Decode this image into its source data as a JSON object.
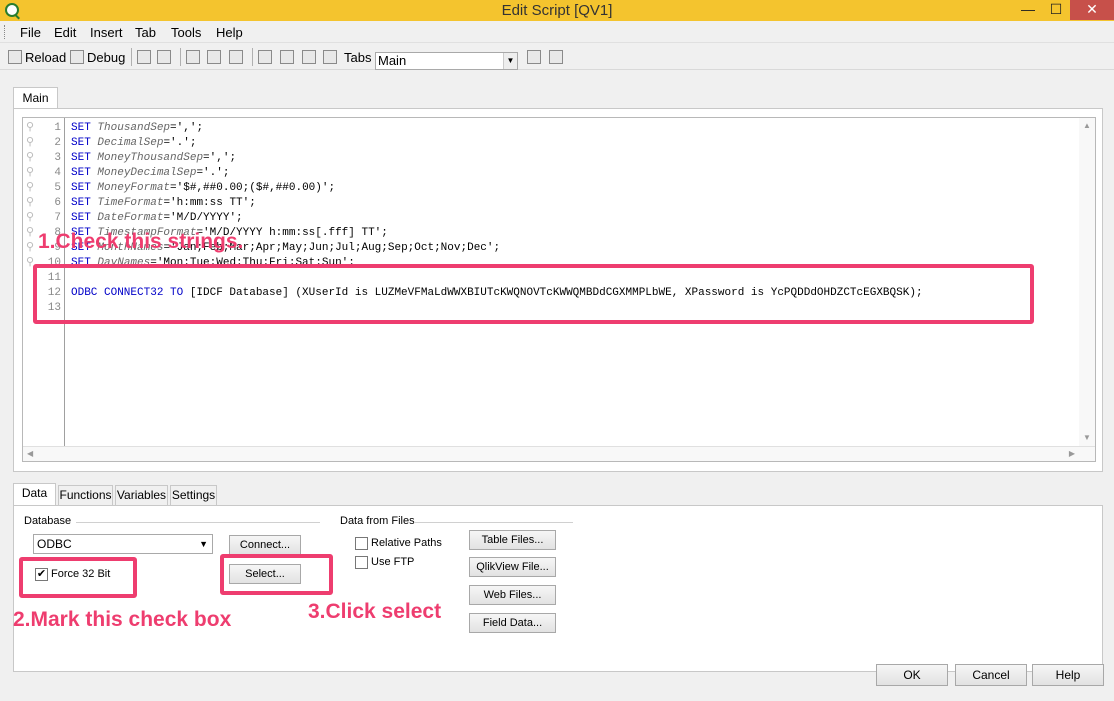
{
  "window": {
    "title": "Edit Script [QV1]",
    "minimize": "—",
    "maximize": "☐",
    "close": "✕"
  },
  "menu": [
    "File",
    "Edit",
    "Insert",
    "Tab",
    "Tools",
    "Help"
  ],
  "toolbar": {
    "reload": "Reload",
    "debug": "Debug",
    "tabs_label": "Tabs",
    "tabs_value": "Main"
  },
  "editor": {
    "tab": "Main",
    "lines": [
      {
        "n": "1",
        "kw": "SET",
        "var": "ThousandSep",
        "val": "=',';"
      },
      {
        "n": "2",
        "kw": "SET",
        "var": "DecimalSep",
        "val": "='.';"
      },
      {
        "n": "3",
        "kw": "SET",
        "var": "MoneyThousandSep",
        "val": "=',';"
      },
      {
        "n": "4",
        "kw": "SET",
        "var": "MoneyDecimalSep",
        "val": "='.';"
      },
      {
        "n": "5",
        "kw": "SET",
        "var": "MoneyFormat",
        "val": "='$#,##0.00;($#,##0.00)';"
      },
      {
        "n": "6",
        "kw": "SET",
        "var": "TimeFormat",
        "val": "='h:mm:ss TT';"
      },
      {
        "n": "7",
        "kw": "SET",
        "var": "DateFormat",
        "val": "='M/D/YYYY';"
      },
      {
        "n": "8",
        "kw": "SET",
        "var": "TimestampFormat",
        "val": "='M/D/YYYY h:mm:ss[.fff] TT';"
      },
      {
        "n": "9",
        "kw": "SET",
        "var": "MonthNames",
        "val": "='Jan;Feb;Mar;Apr;May;Jun;Jul;Aug;Sep;Oct;Nov;Dec';"
      },
      {
        "n": "10",
        "kw": "SET",
        "var": "DayNames",
        "val": "='Mon;Tue;Wed;Thu;Fri;Sat;Sun';"
      },
      {
        "n": "11",
        "kw": "",
        "var": "",
        "val": ""
      },
      {
        "n": "12",
        "kw": "ODBC CONNECT32 TO",
        "var": "",
        "val": " [IDCF Database] (XUserId is LUZMeVFMaLdWWXBIUTcKWQNOVTcKWWQMBDdCGXMMPLbWE, XPassword is YcPQDDdOHDZCTcEGXBQSK);"
      },
      {
        "n": "13",
        "kw": "",
        "var": "",
        "val": ""
      }
    ]
  },
  "bottom_tabs": [
    "Data",
    "Functions",
    "Variables",
    "Settings"
  ],
  "database": {
    "label": "Database",
    "value": "ODBC",
    "connect": "Connect...",
    "select": "Select...",
    "force32": "Force 32 Bit"
  },
  "files": {
    "label": "Data from Files",
    "relative": "Relative Paths",
    "ftp": "Use FTP",
    "table": "Table Files...",
    "qlik": "QlikView File...",
    "web": "Web Files...",
    "field": "Field Data..."
  },
  "dialog": {
    "ok": "OK",
    "cancel": "Cancel",
    "help": "Help"
  },
  "annotations": {
    "a1": "1.Check this strings.",
    "a2": "2.Mark this check box",
    "a3": "3.Click select"
  },
  "colors": {
    "highlight": "#ee3d6f",
    "titlebar": "#f4c42e",
    "keyword": "#0000c8"
  }
}
